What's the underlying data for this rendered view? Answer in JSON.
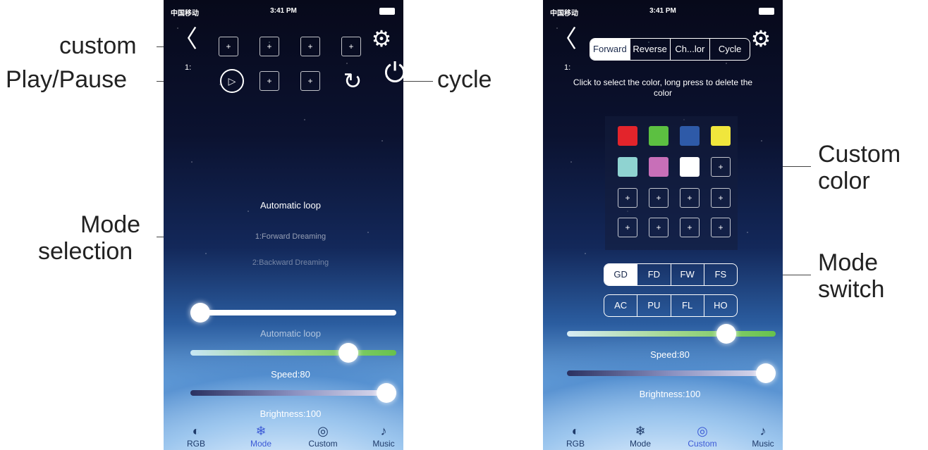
{
  "callouts": {
    "custom": "custom",
    "play_pause": "Play/Pause",
    "cycle": "cycle",
    "mode_selection_l1": "Mode",
    "mode_selection_l2": "selection",
    "custom_color_l1": "Custom",
    "custom_color_l2": "color",
    "mode_switch_l1": "Mode",
    "mode_switch_l2": "switch"
  },
  "left_phone": {
    "status": {
      "carrier": "中国移动",
      "time": "3:41 PM"
    },
    "back_glyph": "〈",
    "gear_glyph": "⚙",
    "counter": "1:",
    "plus": "+",
    "play_glyph": "▷",
    "cycle_glyph": "↻",
    "power_glyph": "⏻",
    "mode_title": "Automatic loop",
    "mode_options": [
      "1:Forward Dreaming",
      "2:Backward Dreaming"
    ],
    "slider1_label": "Automatic loop",
    "speed_label": "Speed:80",
    "brightness_label": "Brightness:100",
    "speed_value": 80,
    "brightness_value": 100
  },
  "right_phone": {
    "status": {
      "carrier": "中国移动",
      "time": "3:41 PM"
    },
    "back_glyph": "〈",
    "gear_glyph": "⚙",
    "counter": "1:",
    "plus": "+",
    "tabs": [
      "Forward",
      "Reverse",
      "Ch...lor",
      "Cycle"
    ],
    "hint": "Click to select the color, long press to delete the color",
    "colors": [
      "#e3242b",
      "#5cc041",
      "#2e5aa8",
      "#f0e63c",
      "#8fd3d1",
      "#c86fb8",
      "#ffffff"
    ],
    "mode_row1": [
      "GD",
      "FD",
      "FW",
      "FS"
    ],
    "mode_row2": [
      "AC",
      "PU",
      "FL",
      "HO"
    ],
    "speed_label": "Speed:80",
    "brightness_label": "Brightness:100",
    "speed_value": 80,
    "brightness_value": 100
  },
  "tabbar": [
    {
      "label": "RGB",
      "icon": "rgb-icon",
      "glyph": "◐"
    },
    {
      "label": "Mode",
      "icon": "snowflake-icon",
      "glyph": "❄"
    },
    {
      "label": "Custom",
      "icon": "custom-icon",
      "glyph": "◎"
    },
    {
      "label": "Music",
      "icon": "music-note-icon",
      "glyph": "♪"
    }
  ]
}
